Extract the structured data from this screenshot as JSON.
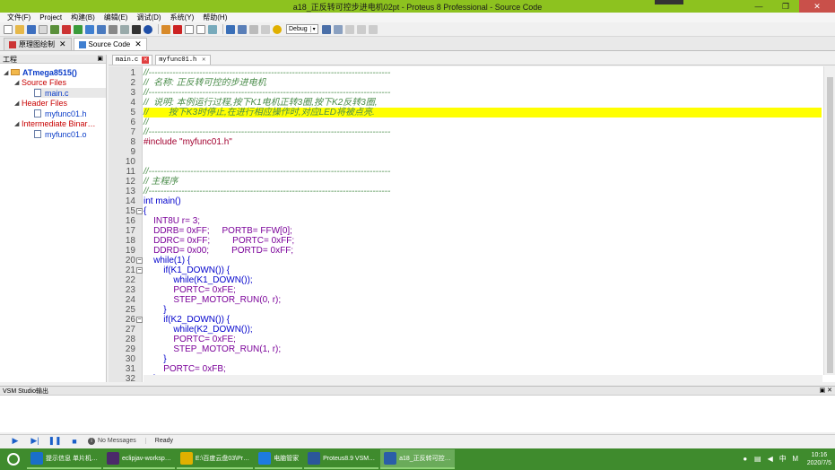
{
  "window": {
    "title": "a18_正反转可控步进电机02pt - Proteus 8 Professional - Source Code",
    "minimize_glyph": "—",
    "maximize_glyph": "❐",
    "close_glyph": "✕"
  },
  "menu": [
    "文件(F)",
    "Project",
    "构建(B)",
    "编辑(E)",
    "调试(D)",
    "系统(Y)",
    "帮助(H)"
  ],
  "toolbar": {
    "build_config": "Debug",
    "caret": "▾"
  },
  "doc_tabs": [
    {
      "label": "原理图绘制",
      "close": "✕"
    },
    {
      "label": "Source Code",
      "close": "✕"
    }
  ],
  "project": {
    "header": "工程",
    "pin": "▣",
    "root": "ATmega8515()",
    "source_files": "Source Files",
    "main_c": "main.c",
    "header_files": "Header Files",
    "myfunc_h": "myfunc01.h",
    "intermediate": "Intermediate Binar…",
    "myfunc_o": "myfunc01.o",
    "expanded_arrow": "◢"
  },
  "editor_tabs": [
    {
      "label": "main.c",
      "close": "✕"
    },
    {
      "label": "myfunc01.h",
      "close": "✕"
    }
  ],
  "code": {
    "fold_open": "−",
    "lines": [
      {
        "n": "1",
        "cls": "cm",
        "t": "//---------------------------------------------------------------------------------"
      },
      {
        "n": "2",
        "cls": "cm",
        "t": "//  名称: 正反转可控的步进电机"
      },
      {
        "n": "3",
        "cls": "cm",
        "t": "//---------------------------------------------------------------------------------"
      },
      {
        "n": "4",
        "cls": "cm",
        "t": "//  说明: 本例运行过程,按下K1电机正转3圈,按下K2反转3圈,"
      },
      {
        "n": "5",
        "cls": "cm",
        "t": "//        按下K3时停止,在进行相应操作时,对应LED将被点亮.",
        "hl": true
      },
      {
        "n": "6",
        "cls": "cm",
        "t": "//"
      },
      {
        "n": "7",
        "cls": "cm",
        "t": "//---------------------------------------------------------------------------------"
      },
      {
        "n": "8",
        "cls": "pp",
        "t": "#include \"myfunc01.h\""
      },
      {
        "n": "9",
        "cls": "",
        "t": ""
      },
      {
        "n": "10",
        "cls": "",
        "t": ""
      },
      {
        "n": "11",
        "cls": "cm",
        "t": "//---------------------------------------------------------------------------------"
      },
      {
        "n": "12",
        "cls": "cm",
        "t": "// 主程序"
      },
      {
        "n": "13",
        "cls": "cm",
        "t": "//---------------------------------------------------------------------------------"
      },
      {
        "n": "14",
        "cls": "kw",
        "t": "int main()"
      },
      {
        "n": "15",
        "cls": "kw",
        "t": "{",
        "fold": true
      },
      {
        "n": "16",
        "cls": "tx",
        "t": "    INT8U r= 3;"
      },
      {
        "n": "17",
        "cls": "tx",
        "t": "    DDRB= 0xFF;     PORTB= FFW[0];"
      },
      {
        "n": "18",
        "cls": "tx",
        "t": "    DDRC= 0xFF;         PORTC= 0xFF;"
      },
      {
        "n": "19",
        "cls": "tx",
        "t": "    DDRD= 0x00;         PORTD= 0xFF;"
      },
      {
        "n": "20",
        "cls": "kw",
        "t": "    while(1) {",
        "fold": true
      },
      {
        "n": "21",
        "cls": "kw",
        "t": "        if(K1_DOWN()) {",
        "fold": true
      },
      {
        "n": "22",
        "cls": "kw",
        "t": "            while(K1_DOWN());"
      },
      {
        "n": "23",
        "cls": "tx",
        "t": "            PORTC= 0xFE;"
      },
      {
        "n": "24",
        "cls": "tx",
        "t": "            STEP_MOTOR_RUN(0, r);"
      },
      {
        "n": "25",
        "cls": "kw",
        "t": "        }"
      },
      {
        "n": "26",
        "cls": "kw",
        "t": "        if(K2_DOWN()) {",
        "fold": true
      },
      {
        "n": "27",
        "cls": "kw",
        "t": "            while(K2_DOWN());"
      },
      {
        "n": "28",
        "cls": "tx",
        "t": "            PORTC= 0xFE;"
      },
      {
        "n": "29",
        "cls": "tx",
        "t": "            STEP_MOTOR_RUN(1, r);"
      },
      {
        "n": "30",
        "cls": "kw",
        "t": "        }"
      },
      {
        "n": "31",
        "cls": "tx",
        "t": "        PORTC= 0xFB;"
      },
      {
        "n": "32",
        "cls": "kw",
        "t": "    }"
      }
    ]
  },
  "output": {
    "title": "VSM Studio输出",
    "pins": "▣ ✕"
  },
  "simbar": {
    "play": "▶",
    "step": "▶|",
    "pause": "❚❚",
    "stop": "■",
    "msg_icon": "i",
    "messages": "No Messages",
    "status": "Ready"
  },
  "taskbar": {
    "items": [
      {
        "label": "提示信息 单片机…",
        "color": "#1a6fc8"
      },
      {
        "label": "eclipjav-worksp…",
        "color": "#4b2a6a"
      },
      {
        "label": "E:\\百度云盘03\\Pr…",
        "color": "#e0b000"
      },
      {
        "label": "电脑管家",
        "color": "#1e7be0"
      },
      {
        "label": "Proteus8.9 VSM…",
        "color": "#2b579a"
      },
      {
        "label": "a18_正反转可控…",
        "color": "#2a5ea8",
        "active": true
      }
    ],
    "tray_ime": "中",
    "tray_m": "M",
    "time": "10:16",
    "date": "2020/7/5"
  }
}
